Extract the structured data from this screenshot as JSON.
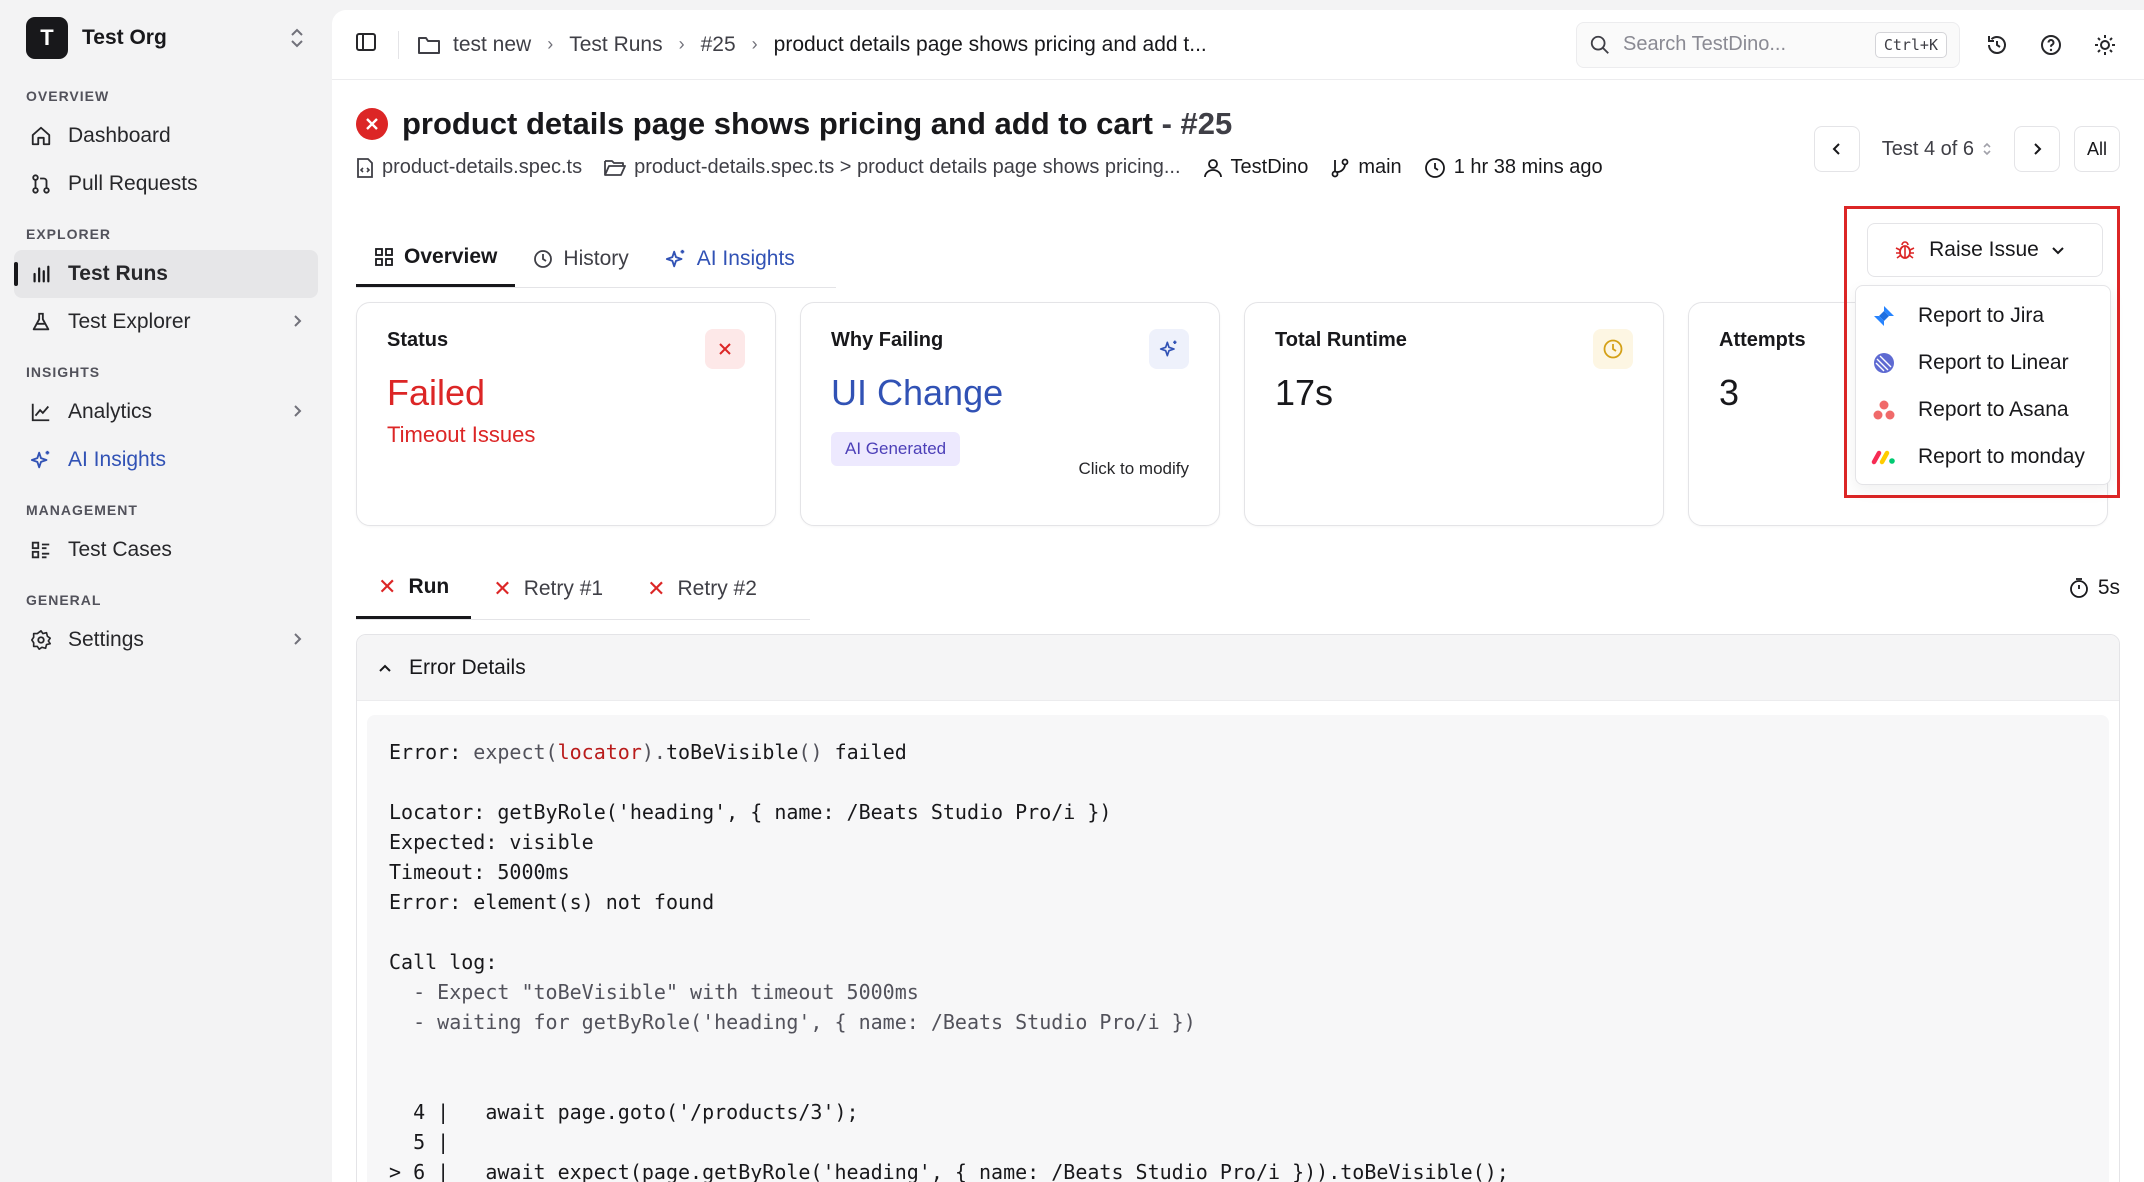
{
  "org": {
    "initial": "T",
    "name": "Test Org"
  },
  "sidebar": {
    "sections": [
      {
        "label": "OVERVIEW",
        "items": [
          {
            "label": "Dashboard"
          },
          {
            "label": "Pull Requests"
          }
        ]
      },
      {
        "label": "EXPLORER",
        "items": [
          {
            "label": "Test Runs"
          },
          {
            "label": "Test Explorer"
          }
        ]
      },
      {
        "label": "INSIGHTS",
        "items": [
          {
            "label": "Analytics"
          },
          {
            "label": "AI Insights"
          }
        ]
      },
      {
        "label": "MANAGEMENT",
        "items": [
          {
            "label": "Test Cases"
          }
        ]
      },
      {
        "label": "GENERAL",
        "items": [
          {
            "label": "Settings"
          }
        ]
      }
    ]
  },
  "breadcrumb": [
    "test new",
    "Test Runs",
    "#25",
    "product details page shows pricing and add t..."
  ],
  "search": {
    "placeholder": "Search TestDino...",
    "shortcut": "Ctrl+K"
  },
  "header": {
    "title": "product details page shows pricing and add to cart",
    "number": " - #25",
    "file": "product-details.spec.ts",
    "path": "product-details.spec.ts > product details page shows pricing...",
    "author": "TestDino",
    "branch": "main",
    "time": "1 hr 38 mins ago"
  },
  "pager": {
    "position": "Test 4 of 6",
    "all": "All"
  },
  "tabs": [
    "Overview",
    "History",
    "AI Insights"
  ],
  "cards": {
    "status": {
      "label": "Status",
      "value": "Failed",
      "sub": "Timeout Issues"
    },
    "why": {
      "label": "Why Failing",
      "value": "UI Change",
      "pill": "AI Generated",
      "action": "Click to modify"
    },
    "runtime": {
      "label": "Total Runtime",
      "value": "17s"
    },
    "attempts": {
      "label": "Attempts",
      "value": "3"
    }
  },
  "raise_issue": {
    "label": "Raise Issue",
    "items": [
      "Report to Jira",
      "Report to Linear",
      "Report to Asana",
      "Report to monday"
    ]
  },
  "run_tabs": [
    "Run",
    "Retry #1",
    "Retry #2"
  ],
  "duration": "5s",
  "error": {
    "title": "Error Details",
    "l1_a": "Error: ",
    "l1_b": "expect(",
    "l1_c": "locator",
    "l1_d": ").",
    "l1_e": "toBeVisible",
    "l1_f": "() ",
    "l1_g": "failed",
    "l2": "Locator: getByRole('heading', { name: /Beats Studio Pro/i })",
    "l3": "Expected: visible",
    "l4": "Timeout: 5000ms",
    "l5": "Error: element(s) not found",
    "l6": "Call log:",
    "l7": "  - Expect \"toBeVisible\" with timeout 5000ms",
    "l8": "  - waiting for getByRole('heading', { name: /Beats Studio Pro/i })",
    "l9": "  4 |   await page.goto('/products/3');",
    "l10": "  5 |",
    "l11": "> 6 |   await expect(page.getByRole('heading', { name: /Beats Studio Pro/i })).toBeVisible();"
  }
}
